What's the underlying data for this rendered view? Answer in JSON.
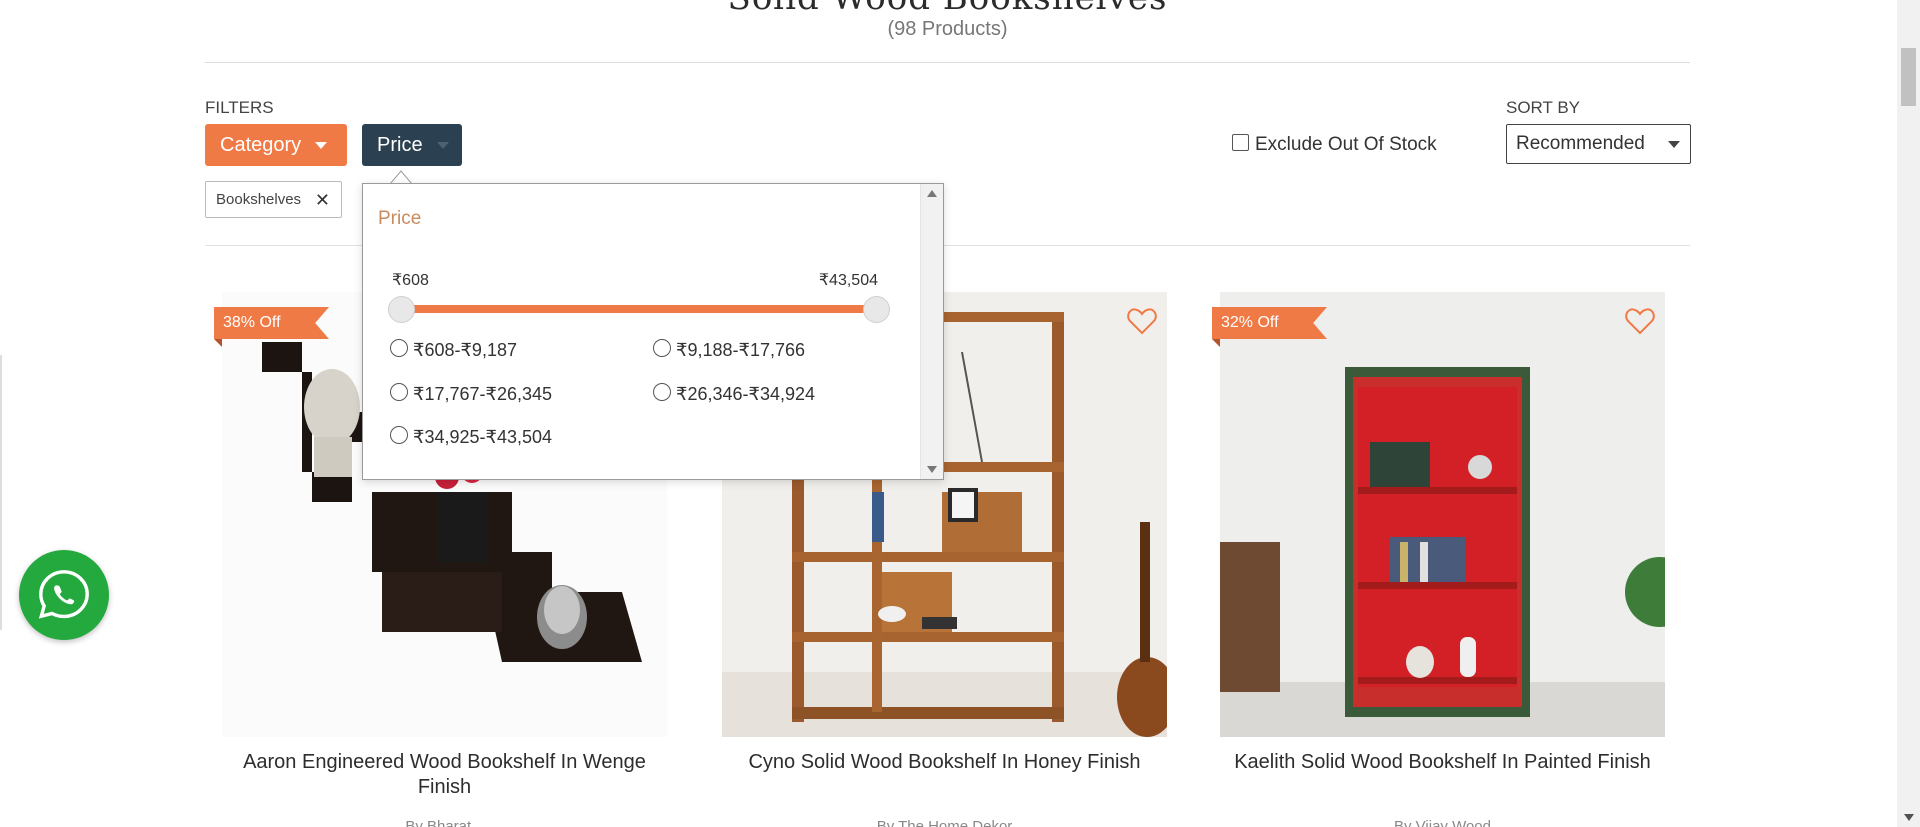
{
  "header": {
    "title": "Solid Wood Bookshelves",
    "count": "(98 Products)"
  },
  "filters": {
    "label": "FILTERS",
    "category_label": "Category",
    "price_label": "Price",
    "exclude_label": "Exclude Out Of Stock",
    "exclude_checked": false,
    "applied_chip": "Bookshelves"
  },
  "sort": {
    "label": "SORT BY",
    "selected": "Recommended"
  },
  "price_dropdown": {
    "title": "Price",
    "min_label": "₹608",
    "max_label": "₹43,504",
    "slider_min_fraction": 0,
    "slider_max_fraction": 1,
    "options": [
      "₹608-₹9,187",
      "₹9,188-₹17,766",
      "₹17,767-₹26,345",
      "₹26,346-₹34,924",
      "₹34,925-₹43,504"
    ]
  },
  "products": [
    {
      "title": "Aaron Engineered Wood Bookshelf In Wenge Finish",
      "brand": "By Bharat...",
      "discount": "38% Off"
    },
    {
      "title": "Cyno Solid Wood Bookshelf In Honey Finish",
      "brand": "By The Home Dekor",
      "discount": ""
    },
    {
      "title": "Kaelith Solid Wood Bookshelf In Painted Finish",
      "brand": "By Vijay Wood",
      "discount": "32% Off"
    }
  ],
  "colors": {
    "accent": "#f07a46",
    "dark_button": "#2b4050",
    "whatsapp": "#23a93e"
  },
  "icons": [
    "close-icon",
    "heart-icon",
    "whatsapp-icon",
    "caret-down-icon"
  ]
}
